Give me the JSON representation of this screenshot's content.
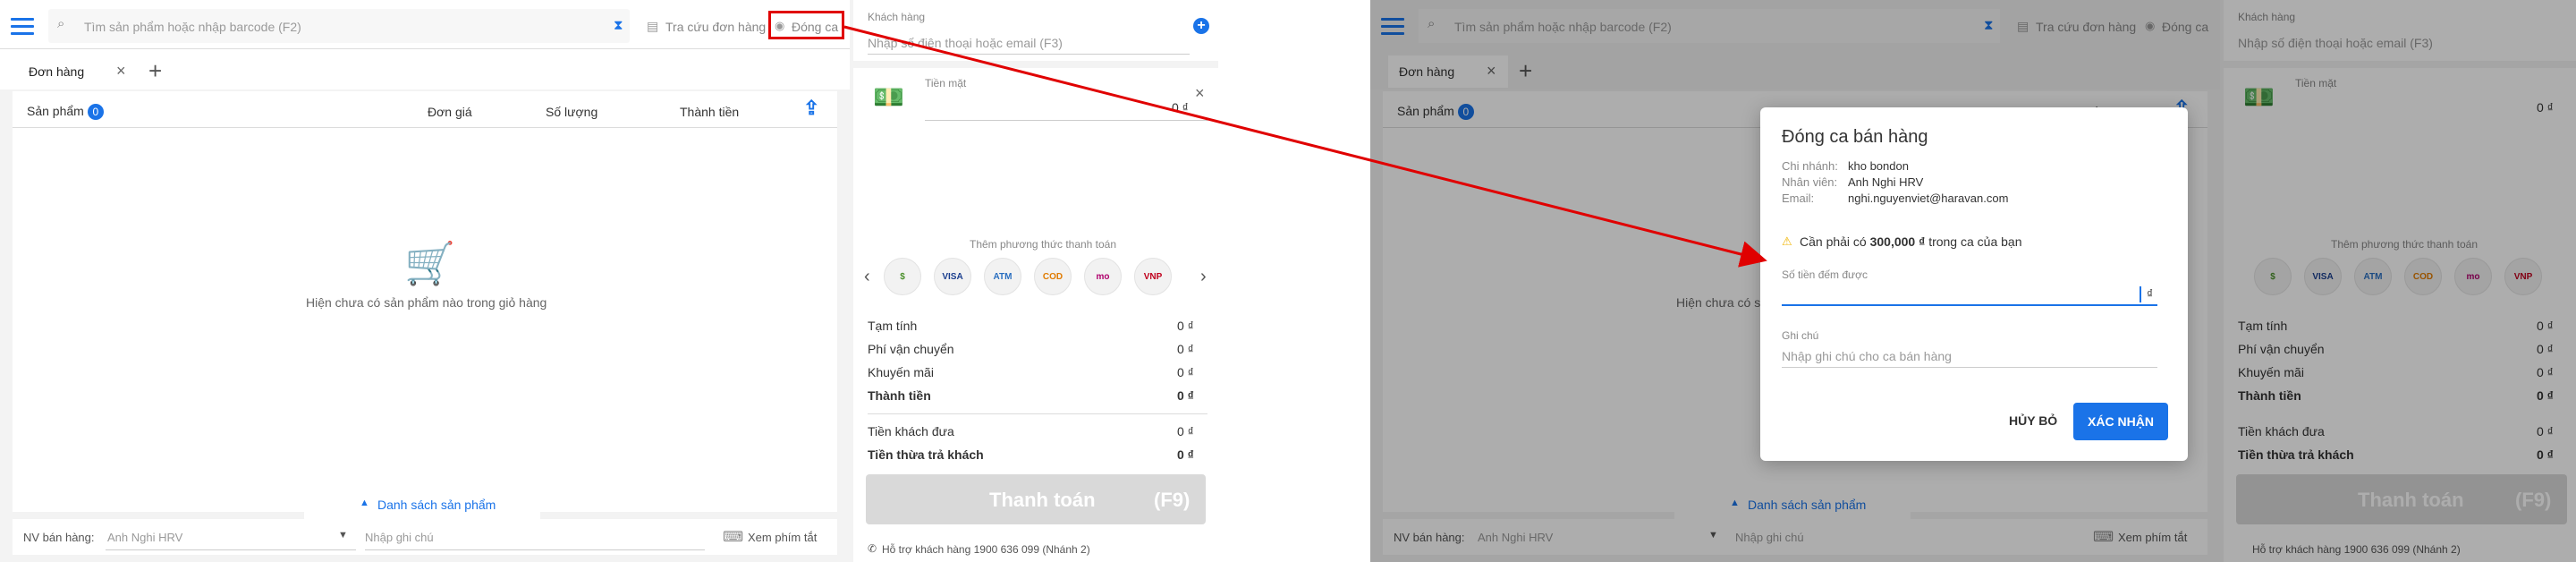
{
  "pos": {
    "search_placeholder": "Tìm sản phẩm hoặc nhập barcode (F2)",
    "lookup_orders": "Tra cứu đơn hàng",
    "close_shift": "Đóng ca",
    "customer_label": "Khách hàng",
    "customer_placeholder": "Nhập số điện thoại hoặc email (F3)",
    "order_tab": "Đơn hàng",
    "col_product": "Sản phẩm",
    "product_count": "0",
    "col_price": "Đơn giá",
    "col_qty": "Số lượng",
    "col_total": "Thành tiền",
    "empty_cart": "Hiện chưa có sản phẩm nào trong giỏ hàng",
    "product_list_toggle": "Danh sách sản phẩm",
    "staff_label": "NV bán hàng:",
    "staff_value": "Anh Nghi HRV",
    "note_placeholder": "Nhập ghi chú",
    "shortcuts": "Xem phím tắt",
    "cash_label": "Tiền mặt",
    "cash_amount": "0 ₫",
    "add_payment": "Thêm phương thức thanh toán",
    "payment_methods": [
      "cash",
      "VISA",
      "ATM",
      "COD",
      "momo",
      "VNPAY"
    ],
    "subtotal_label": "Tạm tính",
    "subtotal_value": "0 ₫",
    "shipping_label": "Phí vận chuyển",
    "shipping_value": "0 ₫",
    "discount_label": "Khuyến mãi",
    "discount_value": "0 ₫",
    "total_label": "Thành tiền",
    "total_value": "0 ₫",
    "paid_label": "Tiền khách đưa",
    "paid_value": "0 ₫",
    "change_label": "Tiền thừa trả khách",
    "change_value": "0 ₫",
    "checkout_label": "Thanh toán",
    "checkout_key": "(F9)",
    "support": "Hỗ trợ khách hàng 1900 636 099 (Nhánh 2)"
  },
  "modal": {
    "title": "Đóng ca bán hàng",
    "branch_label": "Chi nhánh:",
    "branch_value": "kho bondon",
    "staff_label": "Nhân viên:",
    "staff_value": "Anh Nghi HRV",
    "email_label": "Email:",
    "email_value": "nghi.nguyenviet@haravan.com",
    "warning_prefix": "Cần phải có",
    "warning_amount": "300,000 ₫",
    "warning_suffix": "trong ca của bạn",
    "counted_label": "Số tiền đếm được",
    "counted_unit": "₫",
    "note_label": "Ghi chú",
    "note_placeholder": "Nhập ghi chú cho ca bán hàng",
    "cancel": "HỦY BỎ",
    "confirm": "XÁC NHẬN"
  },
  "colors": {
    "accent": "#1a73e8",
    "highlight": "#e00000",
    "arrow": "#e00000"
  }
}
